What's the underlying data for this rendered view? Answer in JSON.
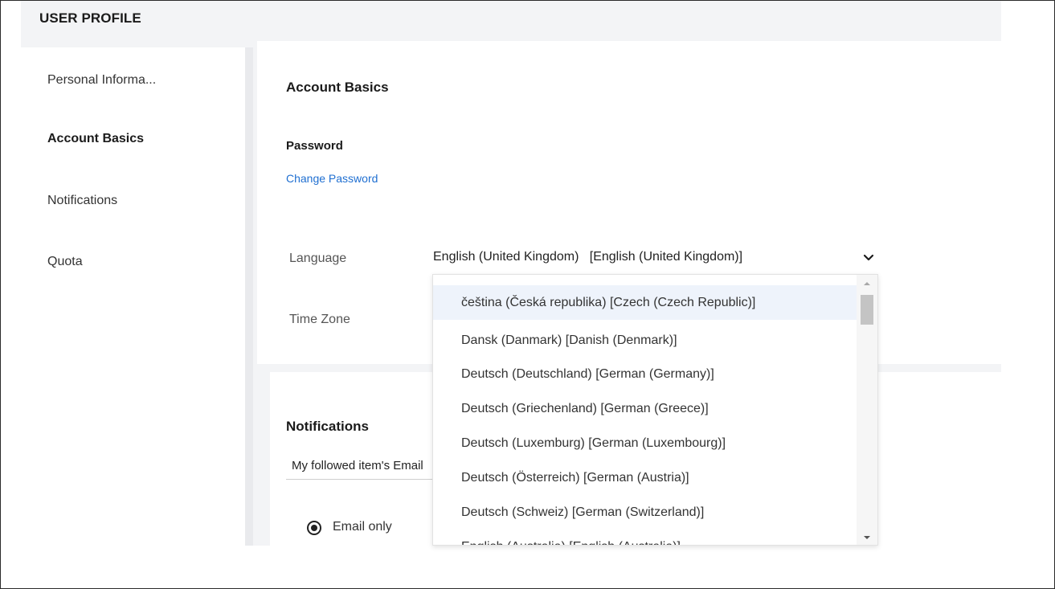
{
  "header": {
    "title": "USER PROFILE"
  },
  "sidebar": {
    "items": [
      {
        "label": "Personal Informa...",
        "active": false
      },
      {
        "label": "Account Basics",
        "active": true
      },
      {
        "label": "Notifications",
        "active": false
      },
      {
        "label": "Quota",
        "active": false
      }
    ]
  },
  "account": {
    "title": "Account Basics",
    "password_label": "Password",
    "change_password_link": "Change Password",
    "language_label": "Language",
    "language_value": "English (United Kingdom)   [English (United Kingdom)]",
    "timezone_label": "Time Zone"
  },
  "language_dropdown": {
    "options": [
      "čeština (Česká republika) [Czech (Czech Republic)]",
      "Dansk (Danmark) [Danish (Denmark)]",
      "Deutsch (Deutschland) [German (Germany)]",
      "Deutsch (Griechenland) [German (Greece)]",
      "Deutsch (Luxemburg) [German (Luxembourg)]",
      "Deutsch (Österreich) [German (Austria)]",
      "Deutsch (Schweiz) [German (Switzerland)]",
      "English (Australia) [English (Australia)]"
    ],
    "highlighted_index": 0
  },
  "notifications": {
    "title": "Notifications",
    "field_value": "My followed item's Email",
    "radio_email_only": "Email only"
  },
  "icons": {
    "chevron": "chevron-down-icon",
    "scroll_up": "caret-up-icon",
    "scroll_down": "caret-down-icon",
    "radio": "radio-selected-icon"
  },
  "colors": {
    "link": "#1f6fd1",
    "app_background": "#f3f4f6",
    "highlight": "#eef3fb"
  }
}
